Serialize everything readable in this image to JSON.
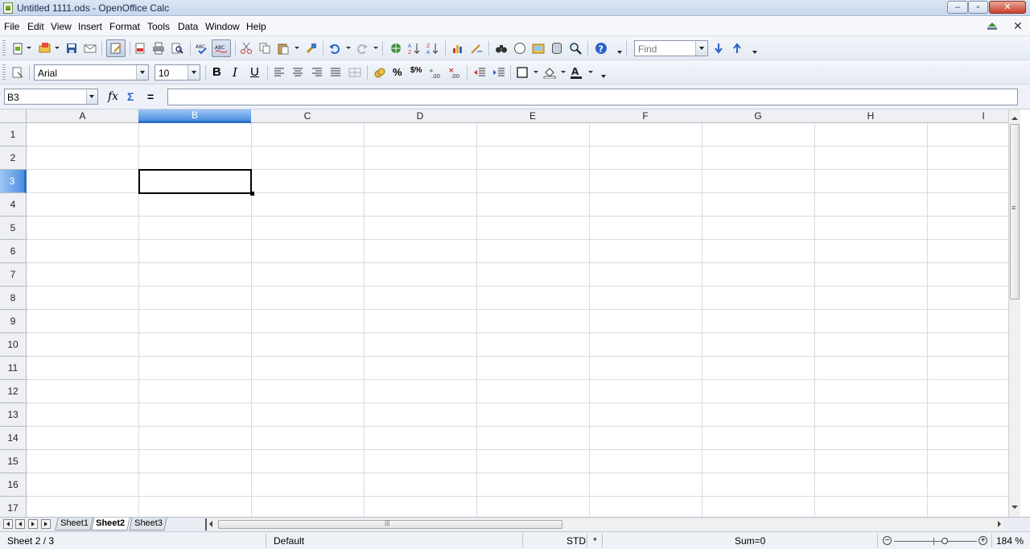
{
  "window": {
    "title": "Untitled 1111.ods - OpenOffice Calc",
    "min": "–",
    "max": "▫",
    "close": "✕"
  },
  "menu": [
    "File",
    "Edit",
    "View",
    "Insert",
    "Format",
    "Tools",
    "Data",
    "Window",
    "Help"
  ],
  "menu_close": "✕",
  "toolbar": {
    "find_placeholder": "Find",
    "font_name": "Arial",
    "font_size": "10",
    "bold": "B",
    "italic": "I",
    "underline": "U",
    "percent": "%",
    "currency": "$%",
    "add_decimal": ".0",
    "del_decimal": ".00"
  },
  "formula_bar": {
    "name_box": "B3",
    "fx": "fx",
    "sum": "Σ",
    "equals": "="
  },
  "sheet": {
    "columns": [
      "A",
      "B",
      "C",
      "D",
      "E",
      "F",
      "G",
      "H",
      "I"
    ],
    "selected_column": "B",
    "rows": [
      "1",
      "2",
      "3",
      "4",
      "5",
      "6",
      "7",
      "8",
      "9",
      "10",
      "11",
      "12",
      "13",
      "14",
      "15",
      "16",
      "17"
    ],
    "selected_row": "3",
    "active_cell": "B3"
  },
  "tabs": [
    "Sheet1",
    "Sheet2",
    "Sheet3"
  ],
  "active_tab": "Sheet2",
  "status": {
    "sheet": "Sheet 2 / 3",
    "style": "Default",
    "mode": "STD",
    "modified": "*",
    "sum": "Sum=0",
    "zoom": "184 %"
  },
  "colors": {
    "selection": "#4a90e2",
    "header_bg": "#eef0f3",
    "grid": "#d8dbe0"
  }
}
